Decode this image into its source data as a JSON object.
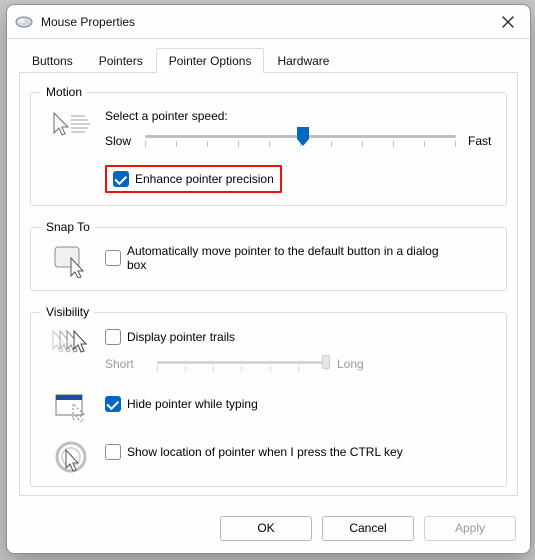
{
  "window": {
    "title": "Mouse Properties"
  },
  "tabs": {
    "buttons": "Buttons",
    "pointers": "Pointers",
    "pointer_options": "Pointer Options",
    "hardware": "Hardware"
  },
  "motion": {
    "legend": "Motion",
    "prompt": "Select a pointer speed:",
    "slow": "Slow",
    "fast": "Fast",
    "speed_value": 6,
    "speed_min": 1,
    "speed_max": 11,
    "enhance_label": "Enhance pointer precision",
    "enhance_checked": true
  },
  "snapto": {
    "legend": "Snap To",
    "auto_label": "Automatically move pointer to the default button in a dialog box",
    "auto_checked": false
  },
  "visibility": {
    "legend": "Visibility",
    "trails_label": "Display pointer trails",
    "trails_checked": false,
    "trails_short": "Short",
    "trails_long": "Long",
    "hide_label": "Hide pointer while typing",
    "hide_checked": true,
    "ctrl_label": "Show location of pointer when I press the CTRL key",
    "ctrl_checked": false
  },
  "buttons": {
    "ok": "OK",
    "cancel": "Cancel",
    "apply": "Apply"
  }
}
